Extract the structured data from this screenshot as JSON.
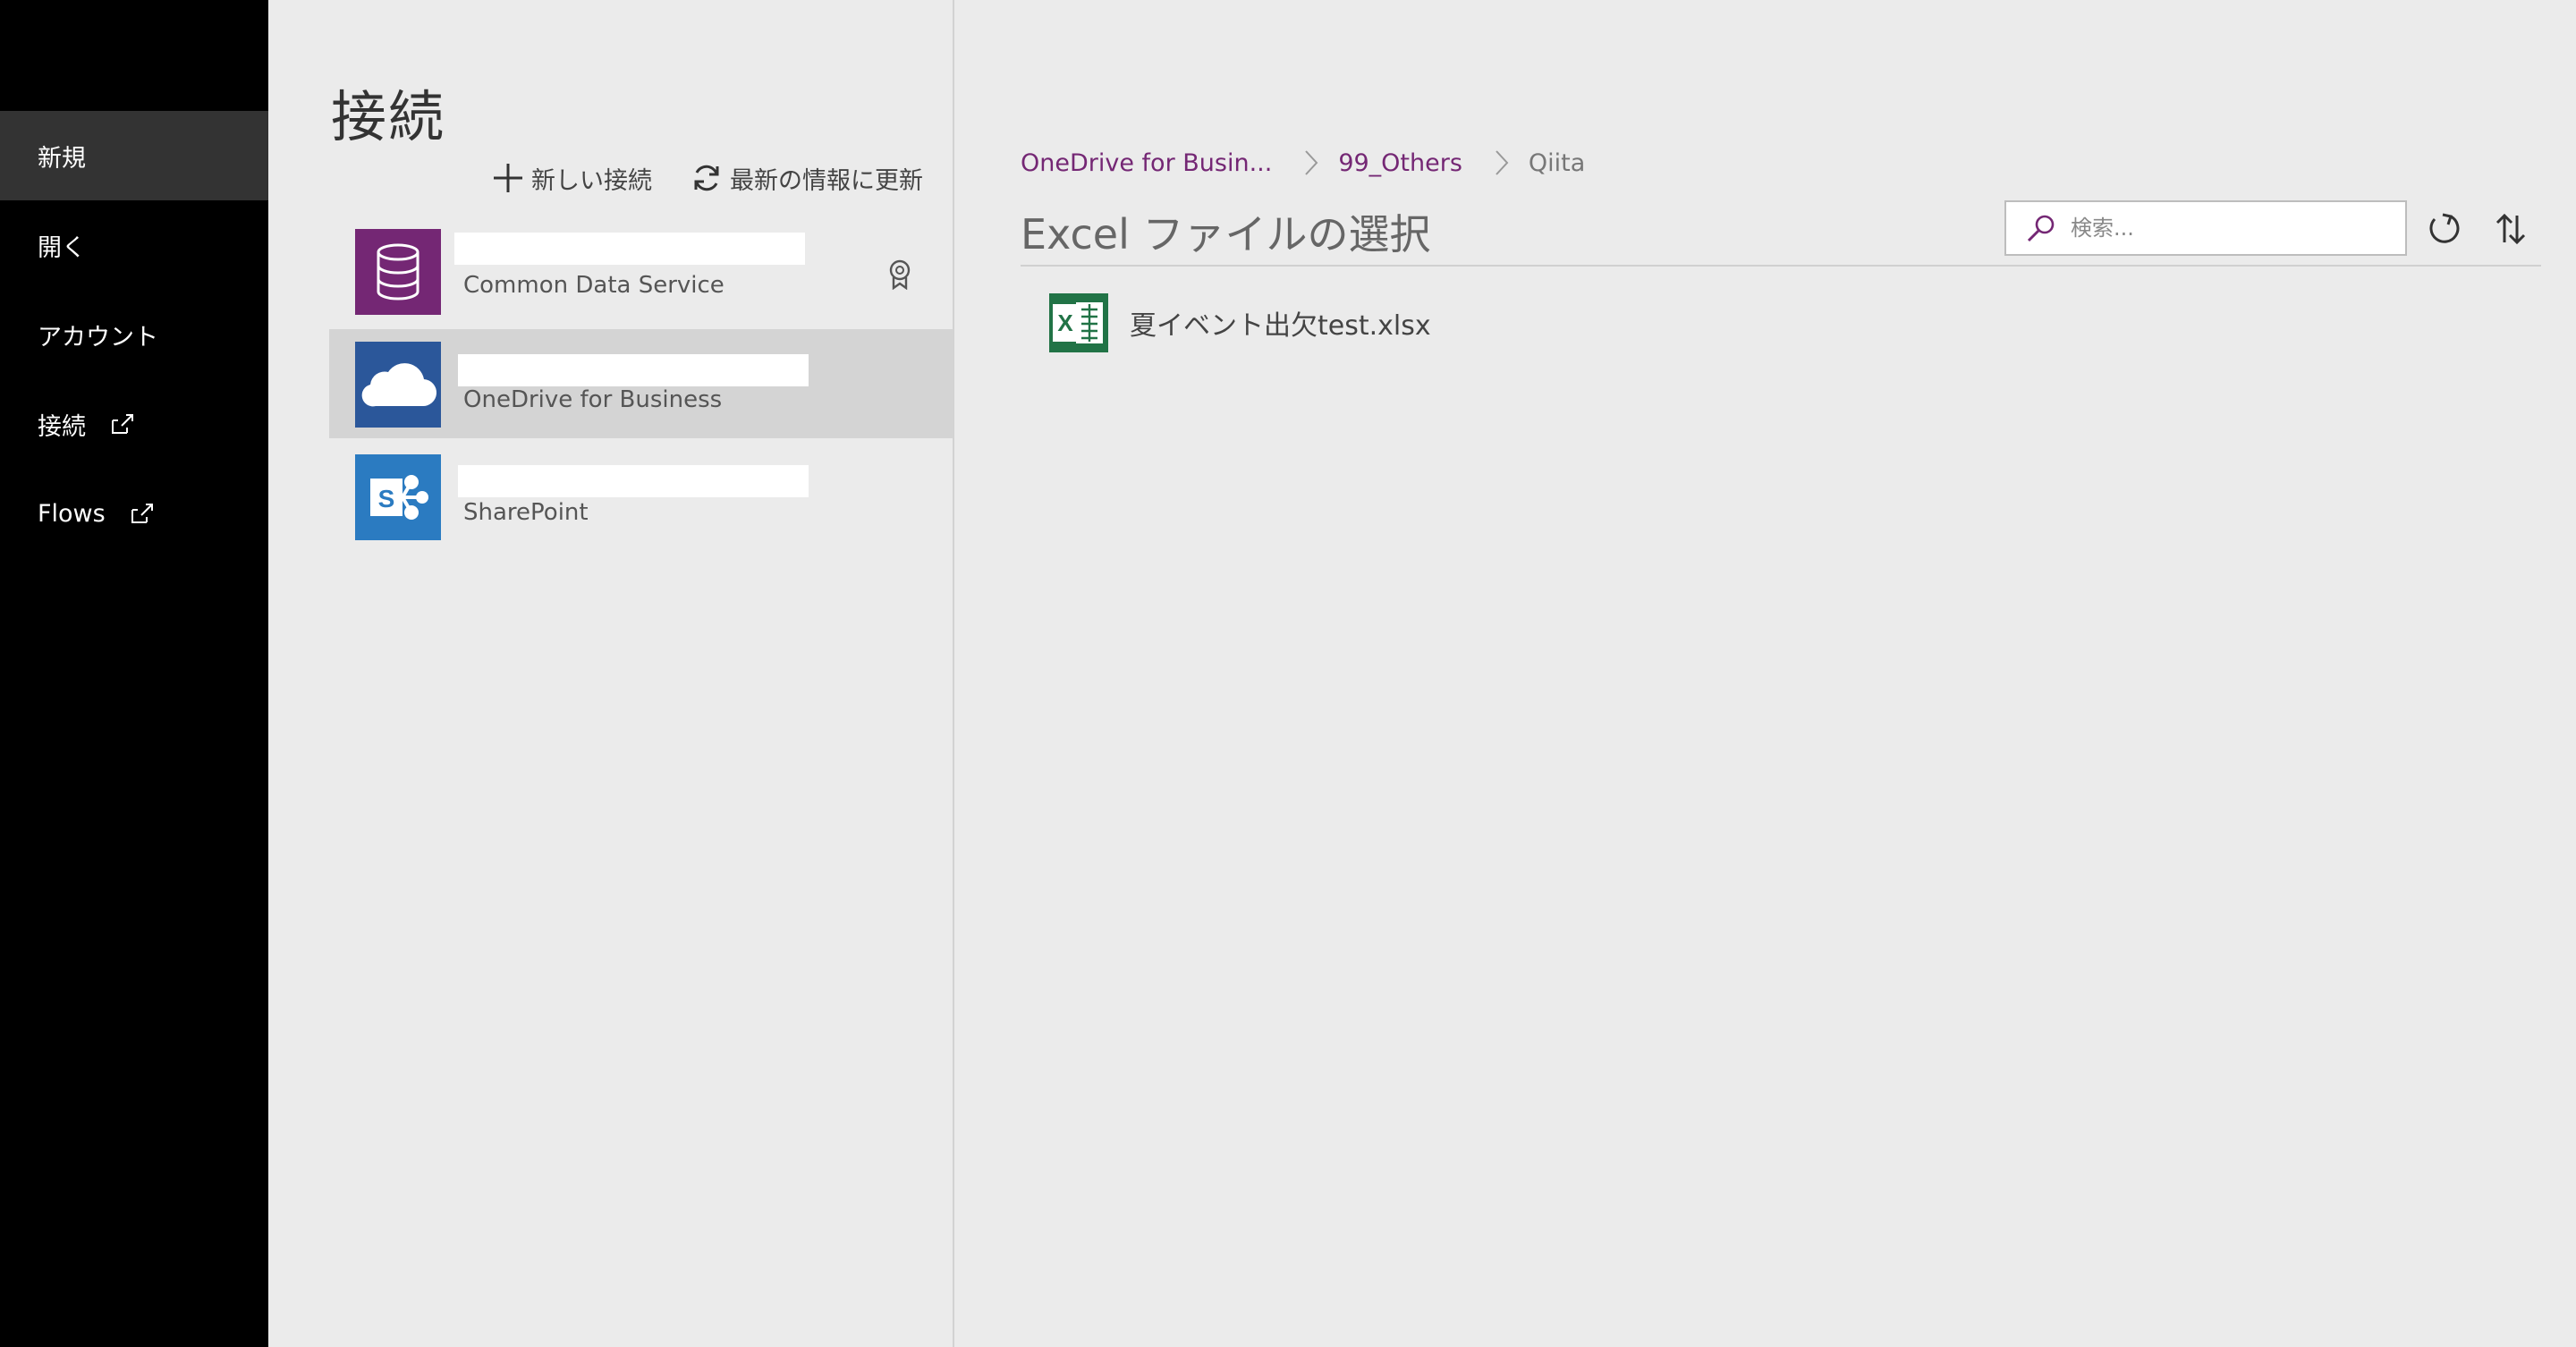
{
  "nav": {
    "items": [
      {
        "label": "新規",
        "external": false,
        "active": true
      },
      {
        "label": "開く",
        "external": false,
        "active": false
      },
      {
        "label": "アカウント",
        "external": false,
        "active": false
      },
      {
        "label": "接続",
        "external": true,
        "active": false
      },
      {
        "label": "Flows",
        "external": true,
        "active": false
      }
    ]
  },
  "connections": {
    "title": "接続",
    "new_label": "新しい接続",
    "refresh_label": "最新の情報に更新",
    "items": [
      {
        "name": "Common Data Service",
        "color": "#742774",
        "icon": "database-icon",
        "premium": true
      },
      {
        "name": "OneDrive for Business",
        "color": "#2b579a",
        "icon": "cloud-icon",
        "selected": true
      },
      {
        "name": "SharePoint",
        "color": "#2b7bc1",
        "icon": "sharepoint-icon"
      }
    ]
  },
  "picker": {
    "breadcrumb": [
      "OneDrive for Busin...",
      "99_Others",
      "Qiita"
    ],
    "title": "Excel ファイルの選択",
    "search_placeholder": "検索...",
    "files": [
      {
        "name": "夏イベント出欠test.xlsx",
        "icon": "excel-file-icon"
      }
    ]
  },
  "colors": {
    "accent": "#742774",
    "nav_bg": "#000000",
    "nav_active": "#333333",
    "excel": "#217346"
  }
}
